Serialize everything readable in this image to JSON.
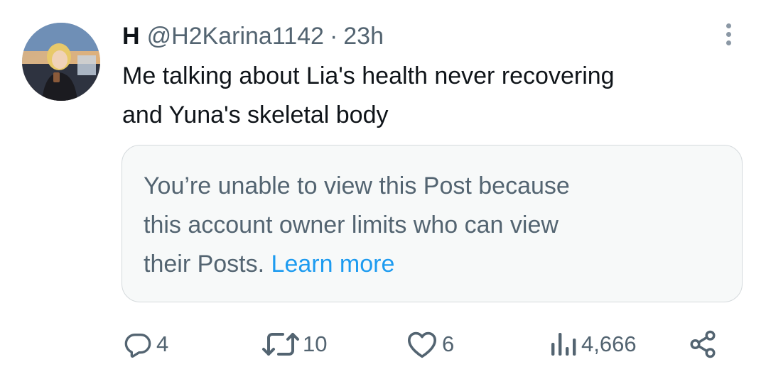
{
  "author": {
    "display_name": "H",
    "handle": "@H2Karina1142",
    "separator": "·",
    "time": "23h",
    "avatar_icon": "profile-photo-avatar"
  },
  "tweet": {
    "text_line1": "Me talking about Lia's health never recovering",
    "text_line2": "and Yuna's skeletal body"
  },
  "quoted_notice": {
    "line1": "You’re unable to view this Post because",
    "line2": "this account owner limits who can view",
    "line3": "their Posts.",
    "link_label": "Learn more"
  },
  "actions": {
    "replies": "4",
    "reposts": "10",
    "likes": "6",
    "views": "4,666",
    "icons": [
      "reply-icon",
      "repost-icon",
      "like-icon",
      "views-icon",
      "share-icon",
      "more-icon"
    ]
  },
  "colors": {
    "text_primary": "#0f1419",
    "text_secondary": "#536471",
    "link": "#1d9bf0",
    "notice_bg": "#f7f9f9",
    "notice_border": "#d5dadd"
  }
}
